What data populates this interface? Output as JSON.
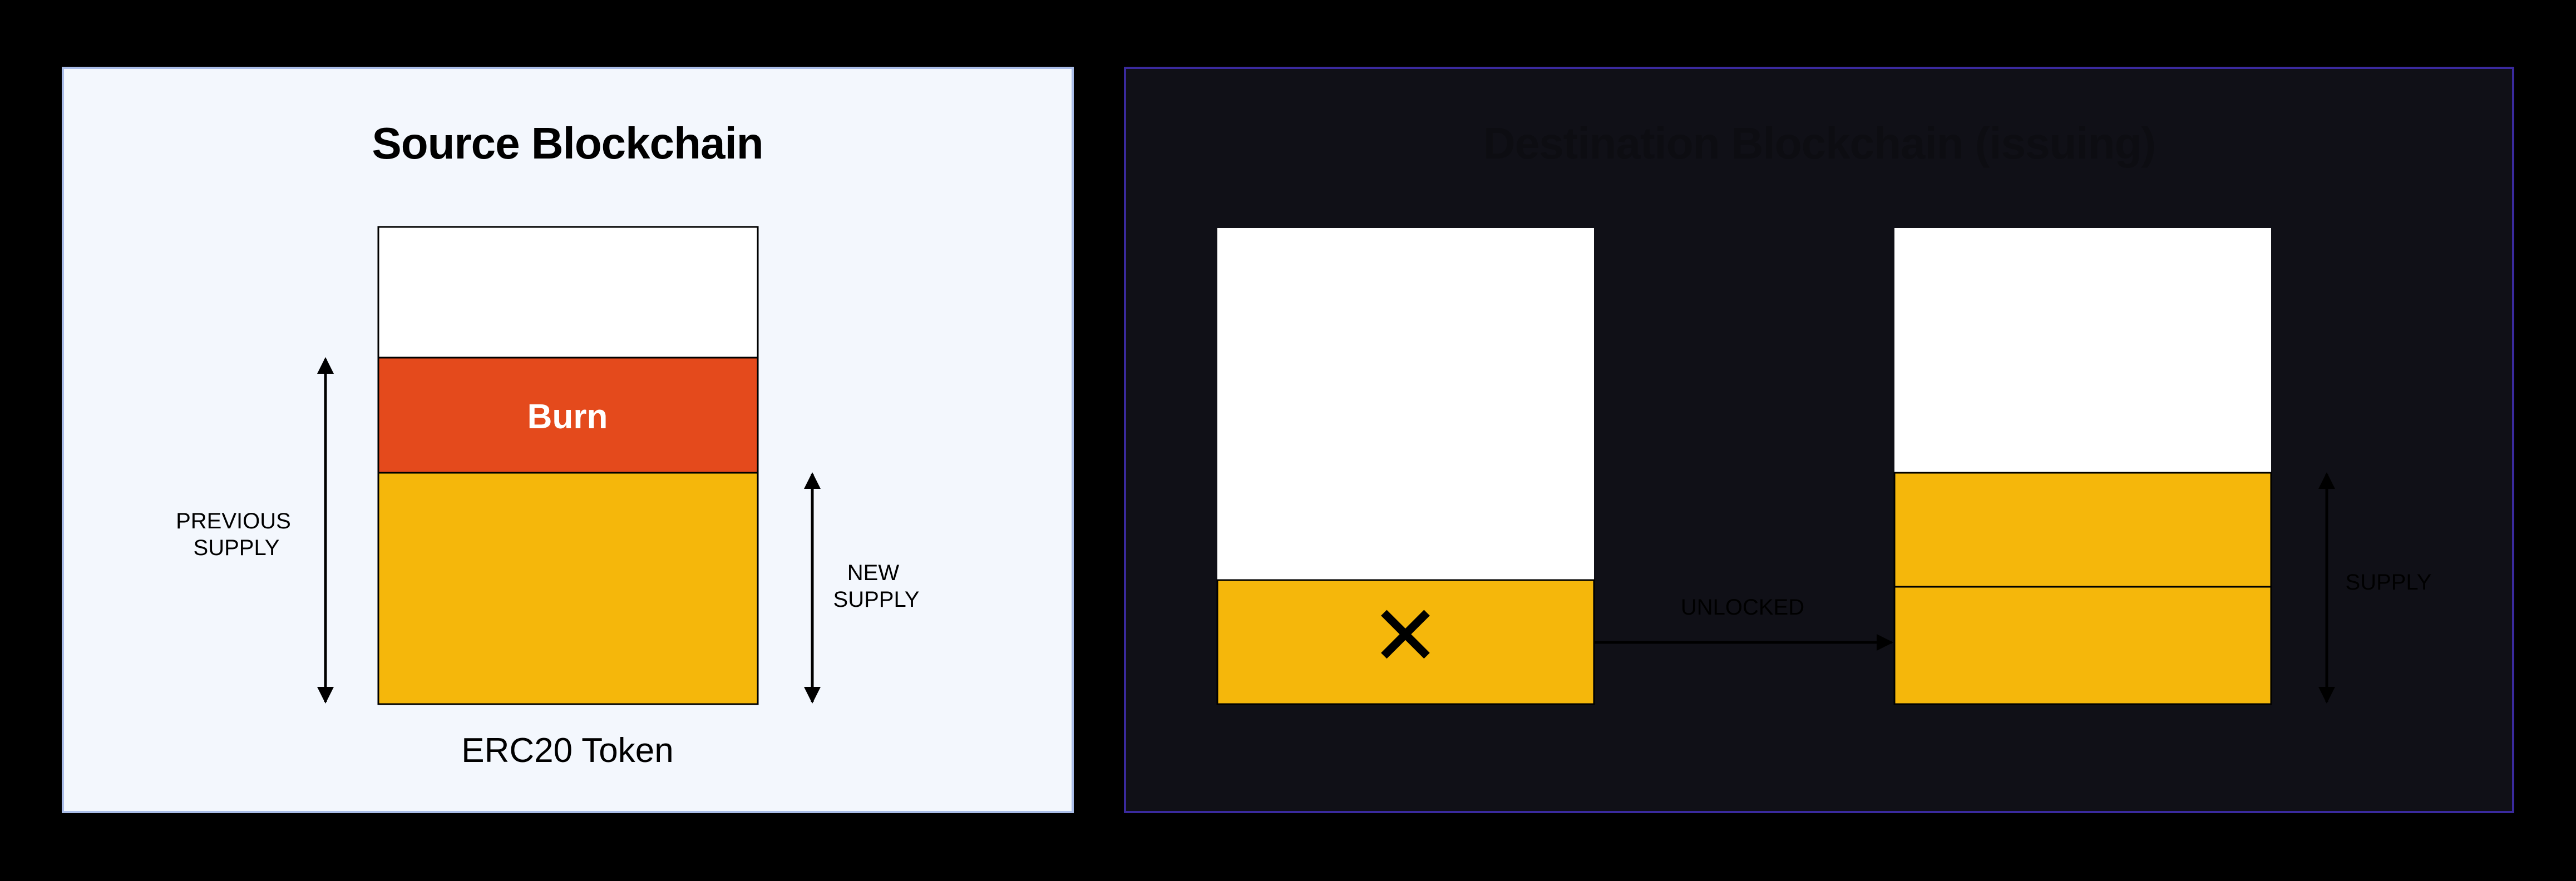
{
  "source": {
    "title": "Source Blockchain",
    "burn_label": "Burn",
    "token_label": "ERC20 Token",
    "previous_supply": [
      "PREVIOUS",
      "SUPPLY"
    ],
    "new_supply": [
      "NEW",
      "SUPPLY"
    ]
  },
  "destination": {
    "title": "Destination Blockchain (issuing)",
    "arrow_label": "UNLOCKED",
    "supply_label": "SUPPLY",
    "x_mark": "✕"
  },
  "colors": {
    "source_bg": "#f3f7fd",
    "source_border": "#aabde8",
    "dest_bg": "#101017",
    "dest_border": "#3a2a9e",
    "burn": "#e44a1c",
    "token": "#f5b70b",
    "empty": "#ffffff",
    "dest_text": "#0d0d12"
  }
}
